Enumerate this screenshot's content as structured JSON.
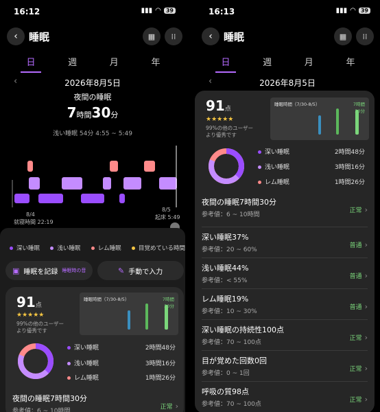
{
  "left": {
    "status": {
      "time": "16:12",
      "battery": "39"
    },
    "header": {
      "title": "睡眠"
    },
    "tabs": [
      "日",
      "週",
      "月",
      "年"
    ],
    "date": "2026年8月5日",
    "summary": {
      "label": "夜間の睡眠",
      "hours": "7",
      "hours_unit": "時間",
      "minutes": "30",
      "minutes_unit": "分",
      "light_info": "浅い睡眠 54分 4:55 ~ 5:49"
    },
    "timeline": {
      "start_date": "8/4",
      "start_label": "就寝時間 22:19",
      "end_date": "8/5",
      "end_label": "起床 5:49"
    },
    "legend": [
      "深い睡眠",
      "浅い睡眠",
      "レム睡眠",
      "目覚めている時間"
    ],
    "buttons": {
      "record": "睡眠を記録",
      "record_sub": "睡眠時の音",
      "manual": "手動で入力"
    },
    "score": {
      "value": "91",
      "unit": "点",
      "stars": "★★★★★",
      "rank_line1": "99%の他のユーザー",
      "rank_line2": "より優秀です",
      "chart_label": "睡眠時間（7/30-8/5）",
      "chart_value": "7時間",
      "chart_value2": "30分"
    },
    "stages": [
      {
        "name": "深い睡眠",
        "value": "2時間48分"
      },
      {
        "name": "浅い睡眠",
        "value": "3時間16分"
      },
      {
        "name": "レム睡眠",
        "value": "1時間26分"
      }
    ],
    "first_metric": {
      "title": "夜間の睡眠7時間30分",
      "ref": "参考値：6 ~ 10時間",
      "status": "正常"
    }
  },
  "right": {
    "status": {
      "time": "16:13",
      "battery": "39"
    },
    "header": {
      "title": "睡眠"
    },
    "tabs": [
      "日",
      "週",
      "月",
      "年"
    ],
    "date": "2026年8月5日",
    "score": {
      "value": "91",
      "unit": "点",
      "stars": "★★★★★",
      "rank_line1": "99%の他のユーザー",
      "rank_line2": "より優秀です",
      "chart_label": "睡眠時間（7/30-8/5）",
      "chart_value": "7時間",
      "chart_value2": "30分"
    },
    "stages": [
      {
        "name": "深い睡眠",
        "value": "2時間48分"
      },
      {
        "name": "浅い睡眠",
        "value": "3時間16分"
      },
      {
        "name": "レム睡眠",
        "value": "1時間26分"
      }
    ],
    "metrics": [
      {
        "title": "夜間の睡眠7時間30分",
        "ref": "参考値：6 ~ 10時間",
        "status": "正常"
      },
      {
        "title": "深い睡眠37%",
        "ref": "参考値：20 ~ 60%",
        "status": "普通"
      },
      {
        "title": "浅い睡眠44%",
        "ref": "参考値：< 55%",
        "status": "普通"
      },
      {
        "title": "レム睡眠19%",
        "ref": "参考値：10 ~ 30%",
        "status": "普通"
      },
      {
        "title": "深い睡眠の持続性100点",
        "ref": "参考値：70 ~ 100点",
        "status": "正常"
      },
      {
        "title": "目が覚めた回数0回",
        "ref": "参考値：0 ~ 1回",
        "status": "正常"
      },
      {
        "title": "呼吸の質98点",
        "ref": "参考値：70 ~ 100点",
        "status": "正常"
      }
    ]
  },
  "colors": {
    "deep": "#9a4dff",
    "light": "#c48cff",
    "rem": "#ff8a8a",
    "awake": "#f5c542",
    "accent": "#b56bff",
    "good": "#7bd67b"
  }
}
